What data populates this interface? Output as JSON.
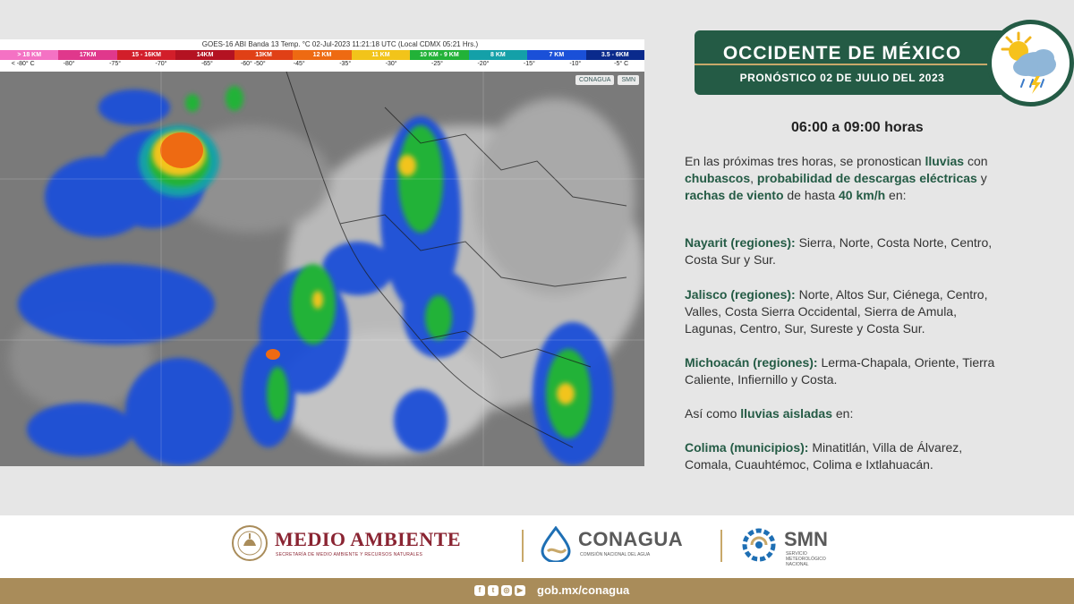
{
  "satellite": {
    "title": "GOES-16 ABI Banda 13 Temp. °C 02-Jul-2023 11:21:18 UTC (Local CDMX 05:21 Hrs.)",
    "scale": [
      {
        "label": "> 18 KM",
        "color": "#f472c4"
      },
      {
        "label": "17KM",
        "color": "#e0388c"
      },
      {
        "label": "15 - 16KM",
        "color": "#d21e2a"
      },
      {
        "label": "14KM",
        "color": "#b41222"
      },
      {
        "label": "13KM",
        "color": "#e04016"
      },
      {
        "label": "12 KM",
        "color": "#ee6a12"
      },
      {
        "label": "11 KM",
        "color": "#f2c41a"
      },
      {
        "label": "10 KM - 9 KM",
        "color": "#22b238"
      },
      {
        "label": "8 KM",
        "color": "#14a0a8"
      },
      {
        "label": "7 KM",
        "color": "#1a50d8"
      },
      {
        "label": "3.5 - 6KM",
        "color": "#0a2a8c"
      }
    ],
    "temps": [
      "< -80° C",
      "-80°",
      "-75°",
      "-70°",
      "-65°",
      "-60° -50°",
      "-45°",
      "-35°",
      "-30°",
      "-25°",
      "-20°",
      "-15°",
      "-10°",
      "-5° C"
    ],
    "logo_conagua": "CONAGUA",
    "logo_smn": "SMN"
  },
  "header": {
    "title": "OCCIDENTE DE MÉXICO",
    "subtitle": "PRONÓSTICO 02 DE JULIO DEL 2023",
    "weather_icon": "sun-cloud-storm-icon"
  },
  "forecast": {
    "hours": "06:00 a 09:00 horas",
    "intro": {
      "l1_a": "En las próximas tres horas, se pronostican ",
      "l1_b": "lluvias",
      "l1_c": " con",
      "l2_a": "chubascos",
      "l2_b": ", ",
      "l2_c": "probabilidad de descargas eléctricas",
      "l2_d": " y",
      "l3_a": "rachas de viento",
      "l3_b": " de hasta ",
      "l3_c": "40 km/h",
      "l3_d": " en:"
    },
    "nayarit": {
      "label": "Nayarit (regiones):",
      "l1": " Sierra, Norte, Costa Norte, Centro,",
      "l2": "Costa Sur y Sur."
    },
    "jalisco": {
      "label": "Jalisco (regiones):",
      "l1": " Norte, Altos Sur, Ciénega, Centro,",
      "l2": "Valles, Costa Sierra Occidental, Sierra de Amula,",
      "l3": "Lagunas, Centro, Sur, Sureste y Costa Sur."
    },
    "michoacan": {
      "label": "Michoacán (regiones):",
      "l1": " Lerma-Chapala, Oriente, Tierra",
      "l2": "Caliente, Infiernillo  y Costa."
    },
    "isolated": {
      "a": "Así como ",
      "b": "lluvias aisladas",
      "c": " en:"
    },
    "colima": {
      "label": "Colima (municipios):",
      "l1": " Minatitlán, Villa de Álvarez,",
      "l2": "Comala, Cuauhtémoc, Colima e Ixtlahuacán."
    }
  },
  "footer": {
    "medio_ambiente": "MEDIO AMBIENTE",
    "medio_ambiente_sub": "SECRETARÍA DE MEDIO AMBIENTE Y RECURSOS NATURALES",
    "conagua": "CONAGUA",
    "conagua_sub": "COMISIÓN NACIONAL DEL AGUA",
    "smn": "SMN",
    "smn_sub": "SERVICIO METEOROLÓGICO NACIONAL",
    "url": "gob.mx/conagua",
    "social": [
      "facebook-icon",
      "twitter-icon",
      "instagram-icon",
      "youtube-icon"
    ]
  },
  "colors": {
    "brand_green": "#245b45",
    "gold": "#a98c5a",
    "wine": "#8a2432"
  }
}
